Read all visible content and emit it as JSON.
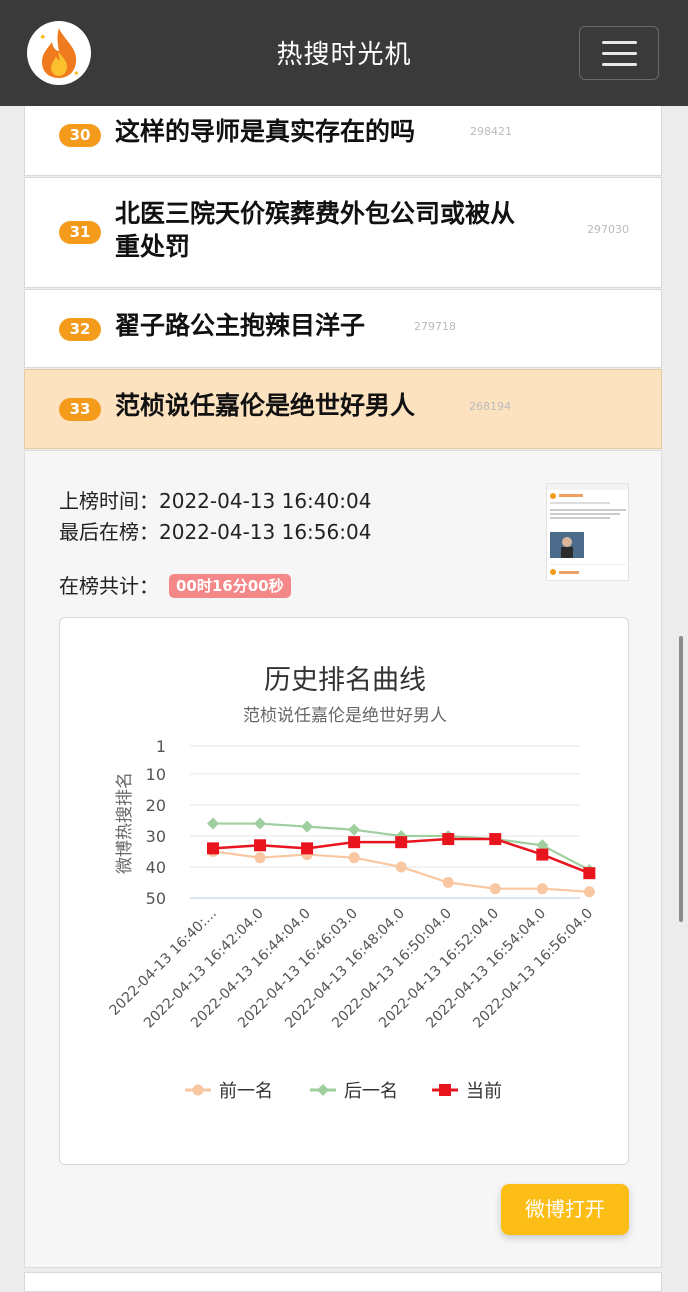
{
  "header": {
    "title": "热搜时光机",
    "logo_icon": "fire-logo-icon",
    "menu_icon": "hamburger-menu-icon"
  },
  "list": [
    {
      "rank": "30",
      "title_lines": [
        "这样的导师是真实存在的吗"
      ],
      "count": "298421"
    },
    {
      "rank": "31",
      "title_lines": [
        "北医三院天价殡葬费外包公司或被从",
        "重处罚"
      ],
      "count": "297030"
    },
    {
      "rank": "32",
      "title_lines": [
        "翟子路公主抱辣目洋子"
      ],
      "count": "279718"
    },
    {
      "rank": "33",
      "title_lines": [
        "范桢说任嘉伦是绝世好男人"
      ],
      "count": "268194",
      "active": true
    }
  ],
  "detail": {
    "first_on_label": "上榜时间：",
    "first_on_value": "2022-04-13 16:40:04",
    "last_on_label": "最后在榜：",
    "last_on_value": "2022-04-13 16:56:04",
    "total_label": "在榜共计：",
    "total_value": "00时16分00秒",
    "open_button": "微博打开"
  },
  "colors": {
    "accent_orange": "#f49b1b",
    "active_row": "#fde2c0",
    "badge_red": "#f48888",
    "button_yellow": "#fbbd16",
    "series_prev": "#f8c7a2",
    "series_next": "#9fce9f",
    "series_current": "#e8141e"
  },
  "chart_data": {
    "type": "line",
    "title": "历史排名曲线",
    "subtitle": "范桢说任嘉伦是绝世好男人",
    "ylabel": "微博热搜排名",
    "y_ticks": [
      "1",
      "10",
      "20",
      "30",
      "40",
      "50"
    ],
    "y_inverted": true,
    "ylim": [
      1,
      50
    ],
    "grid": true,
    "legend_position": "bottom",
    "x": [
      "2022-04-13 16:40:04.0",
      "2022-04-13 16:42:04.0",
      "2022-04-13 16:44:04.0",
      "2022-04-13 16:46:03.0",
      "2022-04-13 16:48:04.0",
      "2022-04-13 16:50:04.0",
      "2022-04-13 16:52:04.0",
      "2022-04-13 16:54:04.0",
      "2022-04-13 16:56:04.0"
    ],
    "x_tick_labels": [
      "2022-04-13 16:40:...",
      "2022-04-13 16:42:04.0",
      "2022-04-13 16:44:04.0",
      "2022-04-13 16:46:03.0",
      "2022-04-13 16:48:04.0",
      "2022-04-13 16:50:04.0",
      "2022-04-13 16:52:04.0",
      "2022-04-13 16:54:04.0",
      "2022-04-13 16:56:04.0"
    ],
    "series": [
      {
        "name": "前一名",
        "color": "#f8c7a2",
        "marker": "circle",
        "values": [
          35,
          37,
          36,
          37,
          40,
          45,
          47,
          47,
          48
        ]
      },
      {
        "name": "后一名",
        "color": "#9fce9f",
        "marker": "diamond",
        "values": [
          26,
          26,
          27,
          28,
          30,
          30,
          31,
          33,
          41
        ]
      },
      {
        "name": "当前",
        "color": "#e8141e",
        "marker": "square",
        "values": [
          34,
          33,
          34,
          32,
          32,
          31,
          31,
          36,
          42
        ]
      }
    ]
  }
}
